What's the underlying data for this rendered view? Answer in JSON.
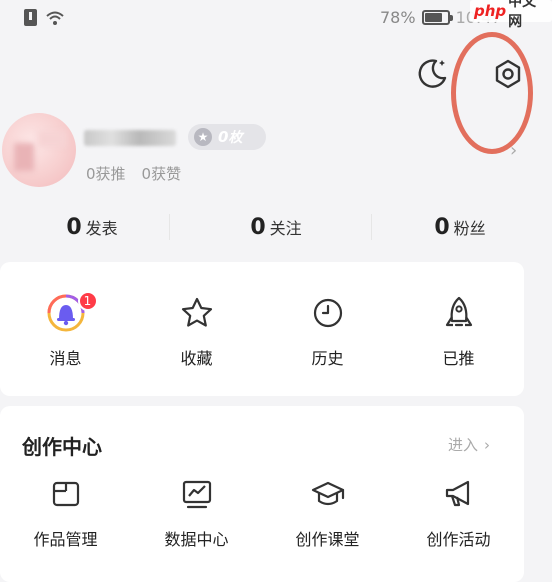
{
  "status_bar": {
    "battery_text": "78%",
    "battery_level": 0.78,
    "time": "10:47",
    "watermark_php": "php",
    "watermark_cn": "中文网"
  },
  "header": {
    "night_mode_icon": "moon-icon",
    "settings_icon": "hexagon-settings-icon",
    "annotation_color": "#e0604c"
  },
  "profile": {
    "username": "",
    "coin_count": "0",
    "coin_unit": "枚",
    "recommended": "0获推",
    "likes": "0获赞"
  },
  "counts": [
    {
      "num": "0",
      "label": "发表"
    },
    {
      "num": "0",
      "label": "关注"
    },
    {
      "num": "0",
      "label": "粉丝"
    }
  ],
  "quick_actions": [
    {
      "label": "消息",
      "icon": "bell-icon",
      "badge": "1"
    },
    {
      "label": "收藏",
      "icon": "star-icon"
    },
    {
      "label": "历史",
      "icon": "clock-icon"
    },
    {
      "label": "已推",
      "icon": "rocket-icon"
    }
  ],
  "creation": {
    "title": "创作中心",
    "enter": "进入",
    "items": [
      {
        "label": "作品管理",
        "icon": "folder-icon"
      },
      {
        "label": "数据中心",
        "icon": "chart-icon"
      },
      {
        "label": "创作课堂",
        "icon": "graduation-cap-icon"
      },
      {
        "label": "创作活动",
        "icon": "megaphone-icon"
      }
    ]
  },
  "colors": {
    "badge_red": "#ff3b47",
    "background": "#f4f4f6"
  }
}
